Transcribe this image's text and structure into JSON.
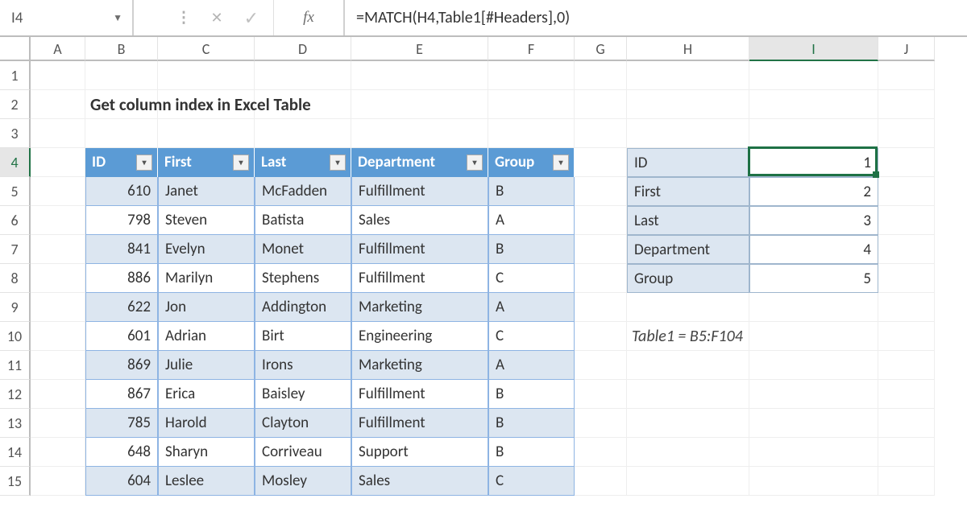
{
  "name_box": "I4",
  "fx_label": "fx",
  "formula": "=MATCH(H4,Table1[#Headers],0)",
  "title": "Get column index in Excel Table",
  "note": "Table1 = B5:F104",
  "columns": [
    "A",
    "B",
    "C",
    "D",
    "E",
    "F",
    "G",
    "H",
    "I",
    "J"
  ],
  "rows": [
    "1",
    "2",
    "3",
    "4",
    "5",
    "6",
    "7",
    "8",
    "9",
    "10",
    "11",
    "12",
    "13",
    "14",
    "15"
  ],
  "selected_col": "I",
  "selected_row": "4",
  "table": {
    "headers": [
      "ID",
      "First",
      "Last",
      "Department",
      "Group"
    ],
    "rows": [
      {
        "id": "610",
        "first": "Janet",
        "last": "McFadden",
        "dept": "Fulfillment",
        "group": "B"
      },
      {
        "id": "798",
        "first": "Steven",
        "last": "Batista",
        "dept": "Sales",
        "group": "A"
      },
      {
        "id": "841",
        "first": "Evelyn",
        "last": "Monet",
        "dept": "Fulfillment",
        "group": "B"
      },
      {
        "id": "886",
        "first": "Marilyn",
        "last": "Stephens",
        "dept": "Fulfillment",
        "group": "C"
      },
      {
        "id": "622",
        "first": "Jon",
        "last": "Addington",
        "dept": "Marketing",
        "group": "A"
      },
      {
        "id": "601",
        "first": "Adrian",
        "last": "Birt",
        "dept": "Engineering",
        "group": "C"
      },
      {
        "id": "869",
        "first": "Julie",
        "last": "Irons",
        "dept": "Marketing",
        "group": "A"
      },
      {
        "id": "867",
        "first": "Erica",
        "last": "Baisley",
        "dept": "Fulfillment",
        "group": "B"
      },
      {
        "id": "785",
        "first": "Harold",
        "last": "Clayton",
        "dept": "Fulfillment",
        "group": "B"
      },
      {
        "id": "648",
        "first": "Sharyn",
        "last": "Corriveau",
        "dept": "Support",
        "group": "B"
      },
      {
        "id": "604",
        "first": "Leslee",
        "last": "Mosley",
        "dept": "Sales",
        "group": "C"
      }
    ]
  },
  "lookup": [
    {
      "label": "ID",
      "value": "1"
    },
    {
      "label": "First",
      "value": "2"
    },
    {
      "label": "Last",
      "value": "3"
    },
    {
      "label": "Department",
      "value": "4"
    },
    {
      "label": "Group",
      "value": "5"
    }
  ]
}
